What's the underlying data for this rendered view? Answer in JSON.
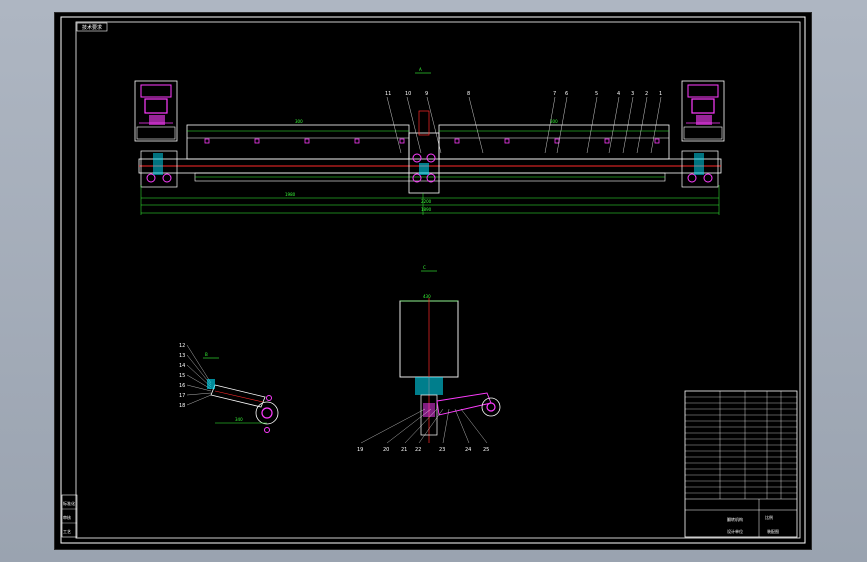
{
  "drawing": {
    "corner_tag": "技术要求",
    "view_a_tag": "A",
    "view_b_tag": "B",
    "view_c_tag": "C",
    "top_part_numbers": [
      "11",
      "10",
      "9",
      "8",
      "7",
      "6",
      "5",
      "4",
      "3",
      "2",
      "1"
    ],
    "left_part_numbers": [
      "12",
      "13",
      "14",
      "15",
      "16",
      "17",
      "18"
    ],
    "bottom_part_numbers": [
      "19",
      "20",
      "21",
      "22",
      "23",
      "24",
      "25"
    ],
    "dims": [
      "300",
      "300",
      "1980",
      "2200",
      "340",
      "430",
      "1890"
    ],
    "title_block": {
      "drawing_name": "翻转机构",
      "scale_label": "比例",
      "company": "设计单位",
      "drawing_no": "装配图"
    },
    "left_stamp": [
      "标准化",
      "审核",
      "工艺"
    ]
  },
  "colors": {
    "sheet": "#000000",
    "outline": "#ffffff",
    "dimension": "#39ff39",
    "section": "#ff2a2a",
    "motor": "#ff3cff",
    "accent": "#00e5ff"
  }
}
